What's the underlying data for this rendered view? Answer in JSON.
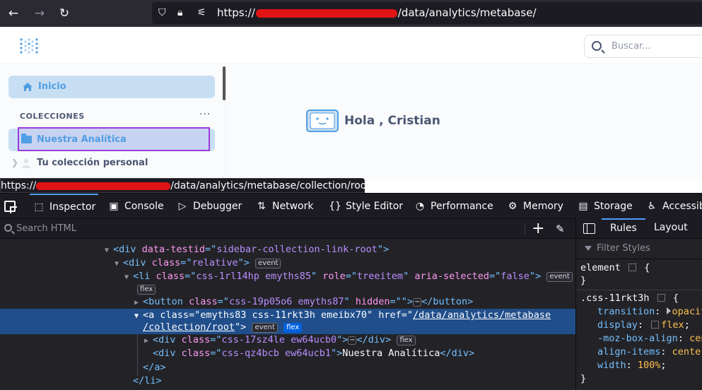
{
  "browser": {
    "url_prefix": "https://",
    "url_suffix": "/data/analytics/metabase/"
  },
  "header": {
    "search_placeholder": "Buscar..."
  },
  "sidebar": {
    "home_label": "Inicio",
    "collections_heading": "COLECCIONES",
    "more_label": "···",
    "collection_label": "Nuestra Analítica",
    "personal_label": "Tu colección personal"
  },
  "main": {
    "greeting": "Hola , Cristian"
  },
  "status_bar": {
    "prefix": "https://",
    "suffix": "/data/analytics/metabase/collection/root"
  },
  "devtools": {
    "tabs": [
      {
        "label": "Inspector",
        "icon": "inspector-icon"
      },
      {
        "label": "Console",
        "icon": "console-icon"
      },
      {
        "label": "Debugger",
        "icon": "debugger-icon"
      },
      {
        "label": "Network",
        "icon": "network-icon"
      },
      {
        "label": "Style Editor",
        "icon": "style-editor-icon"
      },
      {
        "label": "Performance",
        "icon": "performance-icon"
      },
      {
        "label": "Memory",
        "icon": "memory-icon"
      },
      {
        "label": "Storage",
        "icon": "storage-icon"
      },
      {
        "label": "Accessib",
        "icon": "accessibility-icon"
      }
    ],
    "search_placeholder": "Search HTML",
    "side_tabs": {
      "rules": "Rules",
      "layout": "Layout"
    },
    "filter_placeholder": "Filter Styles",
    "tree": {
      "l1": {
        "tag_open": "<div ",
        "attr": "data-testid",
        "eq": "=\"",
        "val": "sidebar-collection-link-root",
        "close": "\">"
      },
      "l2": {
        "tag_open": "<div ",
        "attr": "class",
        "eq": "=\"",
        "val": "relative",
        "close": "\">",
        "badge": "event"
      },
      "l3": {
        "tag_open": "<li ",
        "a1": "class",
        "v1": "css-1rl14hp emyths85",
        "a2": "role",
        "v2": "treeitem",
        "a3": "aria-selected",
        "v3": "false",
        "close": "\">",
        "badge": "event",
        "badge2": "flex"
      },
      "l4": {
        "tag_open": "<button ",
        "attr": "class",
        "val": "css-19p05o6 emyths87",
        "a2": "hidden",
        "v2": "",
        "tail": "</button>"
      },
      "l5": {
        "tag_open": "<a ",
        "a1": "class",
        "v1": "emyths83 css-11rkt3h emeibx70",
        "a2": "href",
        "v2a": "/data/analytics/metabase",
        "v2b": "/collection/root",
        "close": "\">",
        "badge": "event",
        "badge2": "flex"
      },
      "l6": {
        "tag_open": "<div ",
        "attr": "class",
        "val": "css-17sz4le ew64ucb0",
        "close": "\">",
        "tail": "</div>",
        "badge": "flex"
      },
      "l7": {
        "tag_open": "<div ",
        "attr": "class",
        "val": "css-qz4bcb ew64ucb1",
        "close": "\">",
        "text": "Nuestra Analítica",
        "tail": "</div>"
      },
      "l8": {
        "tail": "</a>"
      },
      "l9": {
        "tail": "</li>"
      }
    },
    "rules": {
      "element_sel": "element",
      "brace_open": "{",
      "brace_close": "}",
      "class_sel": ".css-11rkt3h",
      "props": [
        {
          "name": "transition",
          "value": "opacit"
        },
        {
          "name": "display",
          "value": "flex"
        },
        {
          "name": "-moz-box-align",
          "value": "cen"
        },
        {
          "name": "align-items",
          "value": "center"
        },
        {
          "name": "width",
          "value": "100%"
        }
      ]
    }
  }
}
